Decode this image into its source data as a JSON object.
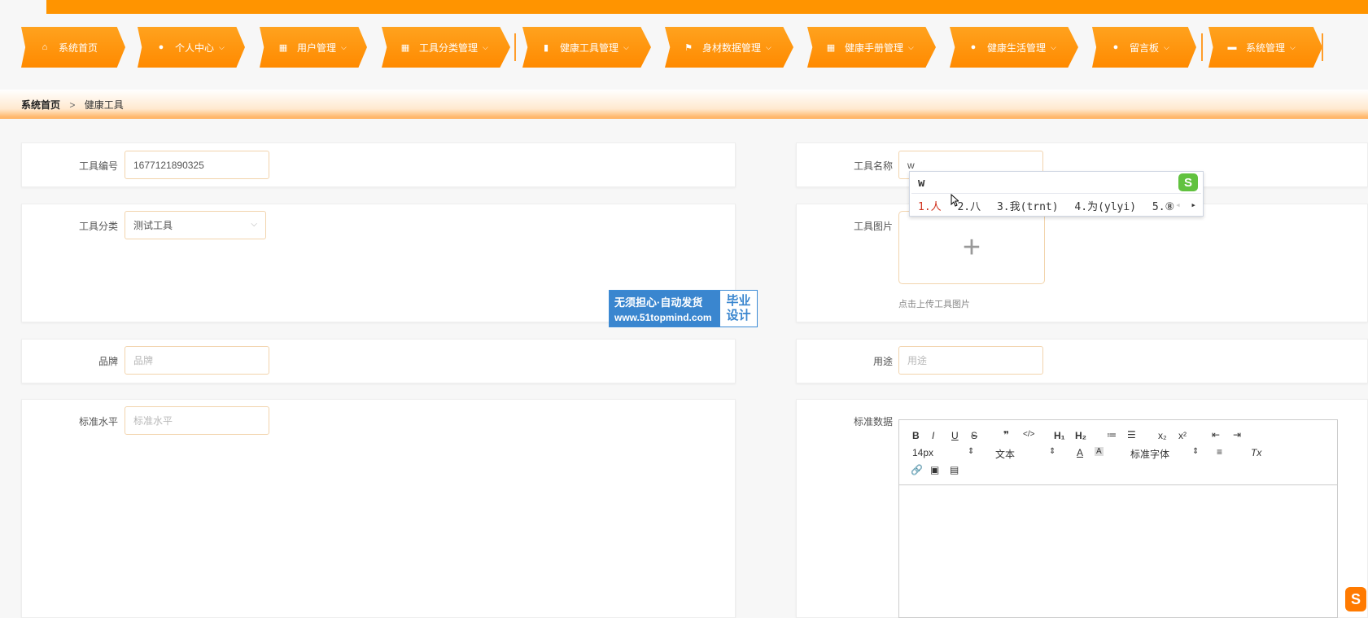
{
  "nav": {
    "items": [
      {
        "label": "系统首页",
        "icon": "home-icon",
        "has_menu": false
      },
      {
        "label": "个人中心",
        "icon": "user-icon",
        "has_menu": true
      },
      {
        "label": "用户管理",
        "icon": "grid-icon",
        "has_menu": true
      },
      {
        "label": "工具分类管理",
        "icon": "grid-icon",
        "has_menu": true
      },
      {
        "label": "健康工具管理",
        "icon": "bar-chart-icon",
        "has_menu": true
      },
      {
        "label": "身材数据管理",
        "icon": "flag-icon",
        "has_menu": true
      },
      {
        "label": "健康手册管理",
        "icon": "grid-icon",
        "has_menu": true
      },
      {
        "label": "健康生活管理",
        "icon": "user-icon",
        "has_menu": true
      },
      {
        "label": "留言板",
        "icon": "bulb-icon",
        "has_menu": true
      },
      {
        "label": "系统管理",
        "icon": "printer-icon",
        "has_menu": true
      }
    ],
    "chevron": "⌵"
  },
  "breadcrumb": {
    "home": "系统首页",
    "separator": ">",
    "current": "健康工具"
  },
  "form": {
    "tool_no": {
      "label": "工具编号",
      "value": "1677121890325"
    },
    "tool_name": {
      "label": "工具名称",
      "value": "w"
    },
    "category": {
      "label": "工具分类",
      "value": "测试工具"
    },
    "image": {
      "label": "工具图片",
      "plus": "+",
      "hint": "点击上传工具图片"
    },
    "brand": {
      "label": "品牌",
      "placeholder": "品牌"
    },
    "usage": {
      "label": "用途",
      "placeholder": "用途"
    },
    "standard_level": {
      "label": "标准水平",
      "placeholder": "标准水平"
    },
    "standard_data": {
      "label": "标准数据"
    }
  },
  "editor": {
    "bold": "B",
    "italic": "I",
    "underline": "U",
    "strike": "S",
    "quote": "❞",
    "code": "</>",
    "h1": "H₁",
    "h2": "H₂",
    "ol": "≔",
    "ul": "☰",
    "sub": "x₂",
    "sup": "x²",
    "outdent": "⇤",
    "indent": "⇥",
    "size": "14px",
    "size_arrow": "⇕",
    "format": "文本",
    "format_arrow": "⇕",
    "color": "A",
    "bg": "A",
    "font": "标准字体",
    "font_arrow": "⇕",
    "align": "≡",
    "clear": "Tx",
    "link": "🔗",
    "image": "▣",
    "video": "▤"
  },
  "ime": {
    "typed": "w",
    "candidates": [
      "1.人",
      "2.八",
      "3.我(trnt)",
      "4.为(ylyi)",
      "5.⑧"
    ],
    "prev": "◂",
    "next": "▸",
    "logo": "S"
  },
  "watermark": {
    "line1": "无须担心·自动发货",
    "line2": "www.51topmind.com",
    "right1": "毕业",
    "right2": "设计"
  },
  "colors": {
    "accent": "#ff9400",
    "input_border": "#f2d4ad"
  }
}
